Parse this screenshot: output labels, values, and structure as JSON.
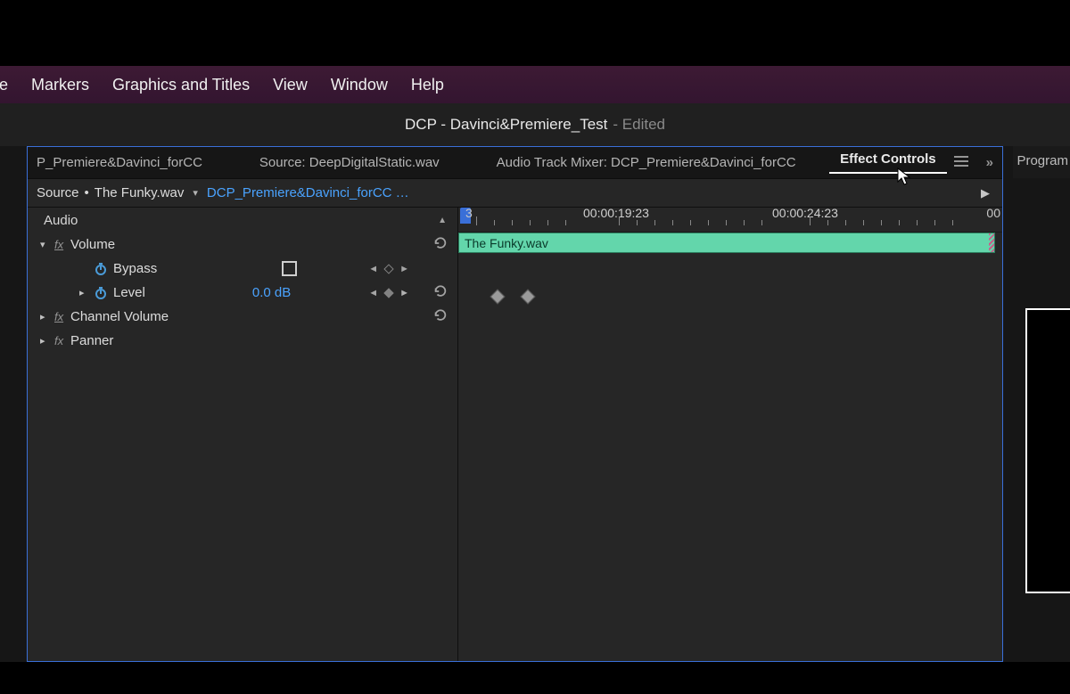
{
  "menu": {
    "items": [
      "ce",
      "Markers",
      "Graphics and Titles",
      "View",
      "Window",
      "Help"
    ]
  },
  "title": {
    "project": "DCP - Davinci&Premiere_Test",
    "suffix": "- Edited"
  },
  "tabs": {
    "t0": "P_Premiere&Davinci_forCC",
    "t1": "Source: DeepDigitalStatic.wav",
    "t2": "Audio Track Mixer: DCP_Premiere&Davinci_forCC",
    "t3": "Effect Controls",
    "right": "Program"
  },
  "source": {
    "prefix": "Source",
    "dot": "•",
    "clip": "The Funky.wav",
    "sequence": "DCP_Premiere&Davinci_forCC •…"
  },
  "effects": {
    "section": "Audio",
    "volume": {
      "label": "Volume",
      "bypass": "Bypass",
      "level": "Level",
      "level_value": "0.0 dB"
    },
    "channel_volume": "Channel Volume",
    "panner": "Panner"
  },
  "ruler": {
    "left_frag": "3",
    "t1": "00:00:19:23",
    "t2": "00:00:24:23",
    "t3": "00"
  },
  "clip": {
    "name": "The Funky.wav"
  }
}
